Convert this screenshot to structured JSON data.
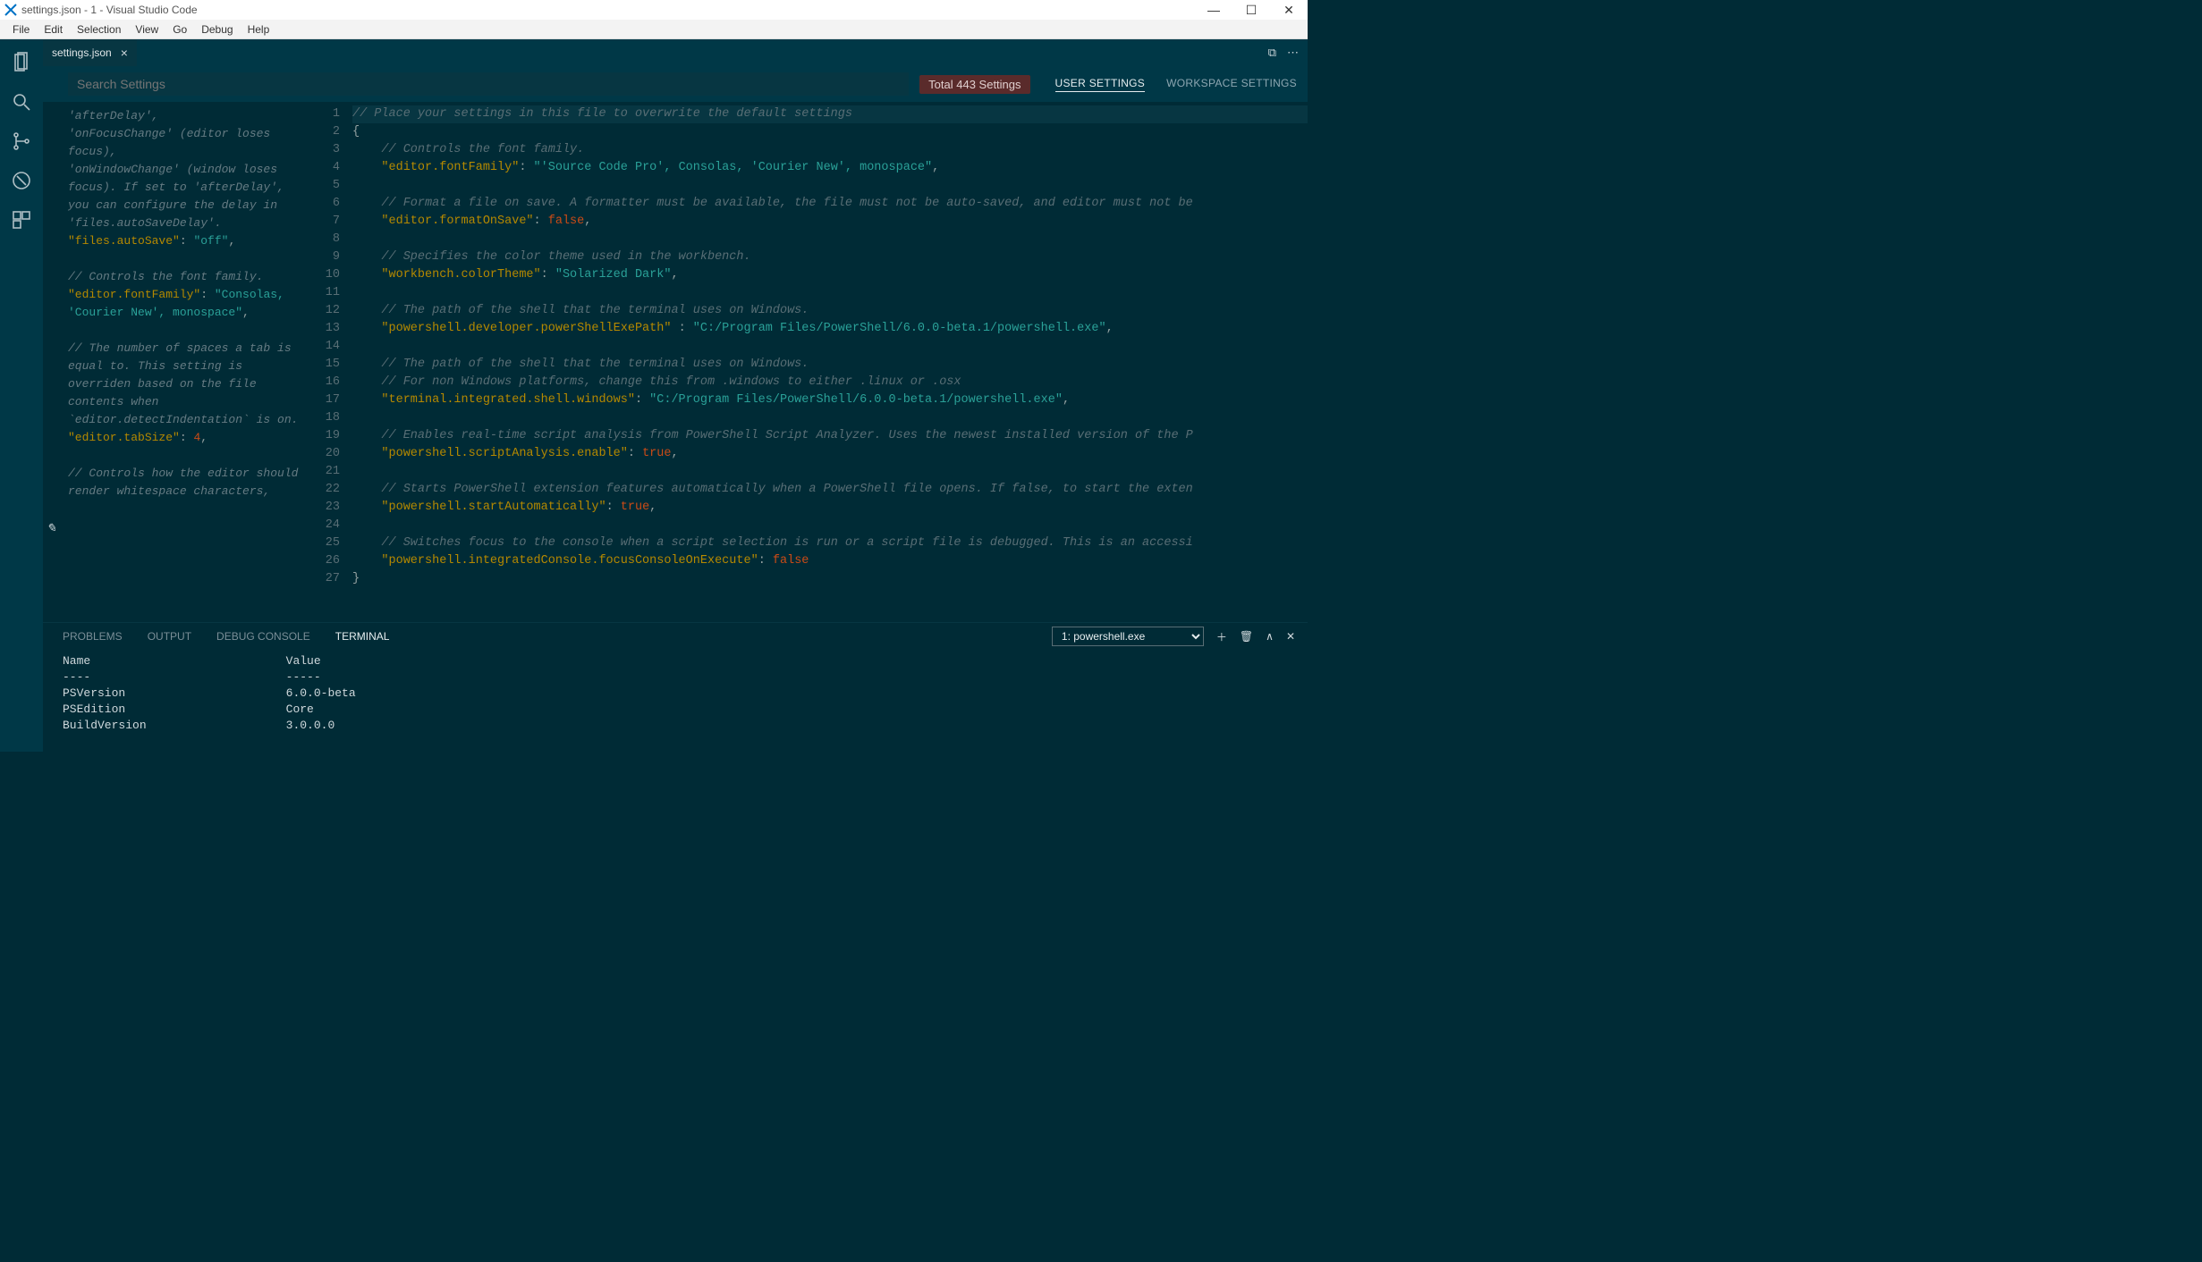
{
  "window": {
    "title": "settings.json - 1 - Visual Studio Code"
  },
  "menu": [
    "File",
    "Edit",
    "Selection",
    "View",
    "Go",
    "Debug",
    "Help"
  ],
  "tab": {
    "name": "settings.json"
  },
  "search": {
    "placeholder": "Search Settings"
  },
  "totalBadge": "Total 443 Settings",
  "settingsTabs": {
    "user": "USER SETTINGS",
    "workspace": "WORKSPACE SETTINGS"
  },
  "defaultPane": {
    "lines": [
      {
        "t": "c",
        "v": "'afterDelay',"
      },
      {
        "t": "c",
        "v": "'onFocusChange' (editor loses focus),"
      },
      {
        "t": "c",
        "v": "'onWindowChange' (window loses focus). If set to 'afterDelay', you can configure the delay in 'files.autoSaveDelay'."
      },
      {
        "t": "kv",
        "k": "\"files.autoSave\"",
        "s": "\"off\"",
        "tail": ","
      },
      {
        "t": "blank"
      },
      {
        "t": "c",
        "v": "// Controls the font family."
      },
      {
        "t": "kv",
        "k": "\"editor.fontFamily\"",
        "s": "\"Consolas, 'Courier New', monospace\"",
        "tail": ","
      },
      {
        "t": "blank"
      },
      {
        "t": "c",
        "v": "// The number of spaces a tab is equal to. This setting is overriden based on the file contents when `editor.detectIndentation` is on."
      },
      {
        "t": "kn",
        "k": "\"editor.tabSize\"",
        "n": "4",
        "tail": ","
      },
      {
        "t": "blank"
      },
      {
        "t": "c",
        "v": "// Controls how the editor should render whitespace characters,"
      }
    ]
  },
  "editor": {
    "lines": [
      {
        "n": 1,
        "seg": [
          {
            "cls": "c",
            "v": "// Place your settings in this file to overwrite the default settings"
          }
        ],
        "hl": true
      },
      {
        "n": 2,
        "seg": [
          {
            "cls": "p",
            "v": "{"
          }
        ]
      },
      {
        "n": 3,
        "seg": [
          {
            "cls": "",
            "v": "    "
          },
          {
            "cls": "c",
            "v": "// Controls the font family."
          }
        ]
      },
      {
        "n": 4,
        "seg": [
          {
            "cls": "",
            "v": "    "
          },
          {
            "cls": "k",
            "v": "\"editor.fontFamily\""
          },
          {
            "cls": "p",
            "v": ": "
          },
          {
            "cls": "s",
            "v": "\"'Source Code Pro', Consolas, 'Courier New', monospace\""
          },
          {
            "cls": "p",
            "v": ","
          }
        ]
      },
      {
        "n": 5,
        "seg": []
      },
      {
        "n": 6,
        "seg": [
          {
            "cls": "",
            "v": "    "
          },
          {
            "cls": "c",
            "v": "// Format a file on save. A formatter must be available, the file must not be auto-saved, and editor must not be"
          }
        ]
      },
      {
        "n": 7,
        "seg": [
          {
            "cls": "",
            "v": "    "
          },
          {
            "cls": "k",
            "v": "\"editor.formatOnSave\""
          },
          {
            "cls": "p",
            "v": ": "
          },
          {
            "cls": "b",
            "v": "false"
          },
          {
            "cls": "p",
            "v": ","
          }
        ]
      },
      {
        "n": 8,
        "seg": []
      },
      {
        "n": 9,
        "seg": [
          {
            "cls": "",
            "v": "    "
          },
          {
            "cls": "c",
            "v": "// Specifies the color theme used in the workbench."
          }
        ]
      },
      {
        "n": 10,
        "seg": [
          {
            "cls": "",
            "v": "    "
          },
          {
            "cls": "k",
            "v": "\"workbench.colorTheme\""
          },
          {
            "cls": "p",
            "v": ": "
          },
          {
            "cls": "s",
            "v": "\"Solarized Dark\""
          },
          {
            "cls": "p",
            "v": ","
          }
        ]
      },
      {
        "n": 11,
        "seg": []
      },
      {
        "n": 12,
        "seg": [
          {
            "cls": "",
            "v": "    "
          },
          {
            "cls": "c",
            "v": "// The path of the shell that the terminal uses on Windows."
          }
        ]
      },
      {
        "n": 13,
        "seg": [
          {
            "cls": "",
            "v": "    "
          },
          {
            "cls": "k",
            "v": "\"powershell.developer.powerShellExePath\""
          },
          {
            "cls": "p",
            "v": " : "
          },
          {
            "cls": "s",
            "v": "\"C:/Program Files/PowerShell/6.0.0-beta.1/powershell.exe\""
          },
          {
            "cls": "p",
            "v": ","
          }
        ]
      },
      {
        "n": 14,
        "seg": []
      },
      {
        "n": 15,
        "seg": [
          {
            "cls": "",
            "v": "    "
          },
          {
            "cls": "c",
            "v": "// The path of the shell that the terminal uses on Windows."
          }
        ]
      },
      {
        "n": 16,
        "seg": [
          {
            "cls": "",
            "v": "    "
          },
          {
            "cls": "c",
            "v": "// For non Windows platforms, change this from .windows to either .linux or .osx"
          }
        ]
      },
      {
        "n": 17,
        "seg": [
          {
            "cls": "",
            "v": "    "
          },
          {
            "cls": "k",
            "v": "\"terminal.integrated.shell.windows\""
          },
          {
            "cls": "p",
            "v": ": "
          },
          {
            "cls": "s",
            "v": "\"C:/Program Files/PowerShell/6.0.0-beta.1/powershell.exe\""
          },
          {
            "cls": "p",
            "v": ","
          }
        ]
      },
      {
        "n": 18,
        "seg": []
      },
      {
        "n": 19,
        "seg": [
          {
            "cls": "",
            "v": "    "
          },
          {
            "cls": "c",
            "v": "// Enables real-time script analysis from PowerShell Script Analyzer. Uses the newest installed version of the P"
          }
        ]
      },
      {
        "n": 20,
        "seg": [
          {
            "cls": "",
            "v": "    "
          },
          {
            "cls": "k",
            "v": "\"powershell.scriptAnalysis.enable\""
          },
          {
            "cls": "p",
            "v": ": "
          },
          {
            "cls": "b",
            "v": "true"
          },
          {
            "cls": "p",
            "v": ","
          }
        ]
      },
      {
        "n": 21,
        "seg": []
      },
      {
        "n": 22,
        "seg": [
          {
            "cls": "",
            "v": "    "
          },
          {
            "cls": "c",
            "v": "// Starts PowerShell extension features automatically when a PowerShell file opens. If false, to start the exten"
          }
        ]
      },
      {
        "n": 23,
        "seg": [
          {
            "cls": "",
            "v": "    "
          },
          {
            "cls": "k",
            "v": "\"powershell.startAutomatically\""
          },
          {
            "cls": "p",
            "v": ": "
          },
          {
            "cls": "b",
            "v": "true"
          },
          {
            "cls": "p",
            "v": ","
          }
        ]
      },
      {
        "n": 24,
        "seg": []
      },
      {
        "n": 25,
        "seg": [
          {
            "cls": "",
            "v": "    "
          },
          {
            "cls": "c",
            "v": "// Switches focus to the console when a script selection is run or a script file is debugged. This is an accessi"
          }
        ]
      },
      {
        "n": 26,
        "seg": [
          {
            "cls": "",
            "v": "    "
          },
          {
            "cls": "k",
            "v": "\"powershell.integratedConsole.focusConsoleOnExecute\""
          },
          {
            "cls": "p",
            "v": ": "
          },
          {
            "cls": "b",
            "v": "false"
          }
        ]
      },
      {
        "n": 27,
        "seg": [
          {
            "cls": "p",
            "v": "}"
          }
        ]
      }
    ]
  },
  "panel": {
    "tabs": [
      "PROBLEMS",
      "OUTPUT",
      "DEBUG CONSOLE",
      "TERMINAL"
    ],
    "activeTab": "TERMINAL",
    "terminalSelect": "1: powershell.exe",
    "terminal": {
      "header1": "Name",
      "header2": "Value",
      "rows": [
        {
          "k": "PSVersion",
          "v": "6.0.0-beta"
        },
        {
          "k": "PSEdition",
          "v": "Core"
        },
        {
          "k": "BuildVersion",
          "v": "3.0.0.0"
        }
      ]
    }
  }
}
